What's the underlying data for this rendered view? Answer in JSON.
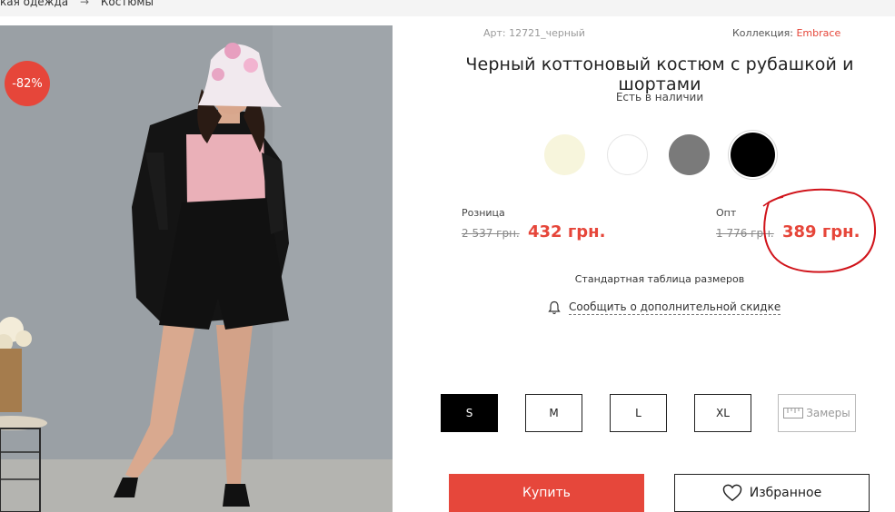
{
  "breadcrumb": {
    "items": [
      "кая одежда",
      "Костюмы"
    ],
    "separator": "→"
  },
  "product": {
    "discount_badge": "-82%",
    "article": "Арт: 12721_черный",
    "collection_label": "Коллекция:",
    "collection_link": "Embrace",
    "title": "Черный коттоновый костюм с рубашкой и шортами",
    "stock_status": "Есть в наличии",
    "colors": [
      {
        "name": "cream",
        "hex": "#f7f5dc"
      },
      {
        "name": "white",
        "hex": "#ffffff"
      },
      {
        "name": "gray",
        "hex": "#7a7a7a"
      },
      {
        "name": "black",
        "hex": "#000000",
        "selected": true
      }
    ]
  },
  "pricing": {
    "retail_label": "Розница",
    "retail_old": "2 537 грн.",
    "retail_new": "432 грн.",
    "wholesale_label": "Опт",
    "wholesale_old": "1 776 грн.",
    "wholesale_new": "389 грн."
  },
  "links": {
    "size_table": "Стандартная таблица размеров",
    "notify_discount": "Сообщить о дополнительной скидке"
  },
  "sizes": {
    "options": [
      "S",
      "M",
      "L",
      "XL"
    ],
    "selected": "S",
    "measurements": "Замеры"
  },
  "actions": {
    "buy": "Купить",
    "favorites": "Избранное"
  },
  "colors": {
    "accent": "#e6463a",
    "annotation_circle": "#d0131a"
  }
}
